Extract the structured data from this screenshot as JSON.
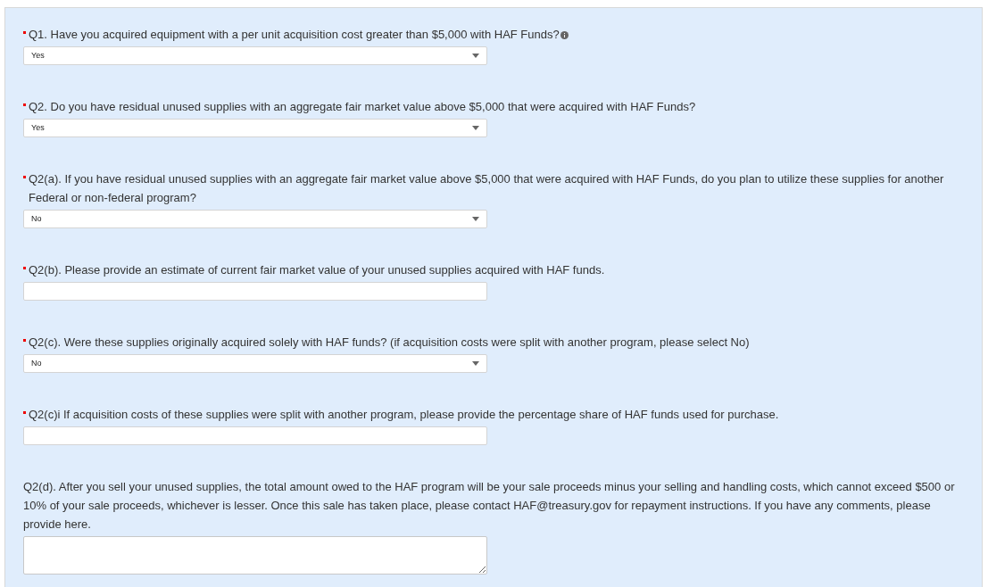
{
  "questions": [
    {
      "kind": "select",
      "required": true,
      "info": true,
      "label": "Q1. Have you acquired equipment with a per unit acquisition cost greater than $5,000 with HAF Funds?",
      "value": "Yes"
    },
    {
      "kind": "select",
      "required": true,
      "info": false,
      "label": "Q2. Do you have residual unused supplies with an aggregate fair market value above $5,000 that were acquired with HAF Funds?",
      "value": "Yes"
    },
    {
      "kind": "select",
      "required": true,
      "info": false,
      "label": "Q2(a). If you have residual unused supplies with an aggregate fair market value above $5,000 that were acquired with HAF Funds, do you plan to utilize these supplies for another Federal or non-federal program?",
      "value": "No"
    },
    {
      "kind": "text",
      "required": true,
      "info": false,
      "label": "Q2(b). Please provide an estimate of current fair market value of your unused supplies acquired with HAF funds."
    },
    {
      "kind": "select",
      "required": true,
      "info": false,
      "label": "Q2(c). Were these supplies originally acquired solely with HAF funds? (if acquisition costs were split with another program, please select No)",
      "value": "No"
    },
    {
      "kind": "text",
      "required": true,
      "info": false,
      "label": "Q2(c)i If acquisition costs of these supplies were split with another program, please provide the percentage share of HAF funds used for purchase."
    },
    {
      "kind": "textarea",
      "required": false,
      "info": false,
      "label": "Q2(d). After you sell your unused supplies, the total amount owed to the HAF program will be your sale proceeds minus your selling and handling costs, which cannot exceed $500 or 10% of your sale proceeds, whichever is lesser. Once this sale has taken place, please contact HAF@treasury.gov for repayment instructions. If you have any comments, please provide here."
    }
  ]
}
